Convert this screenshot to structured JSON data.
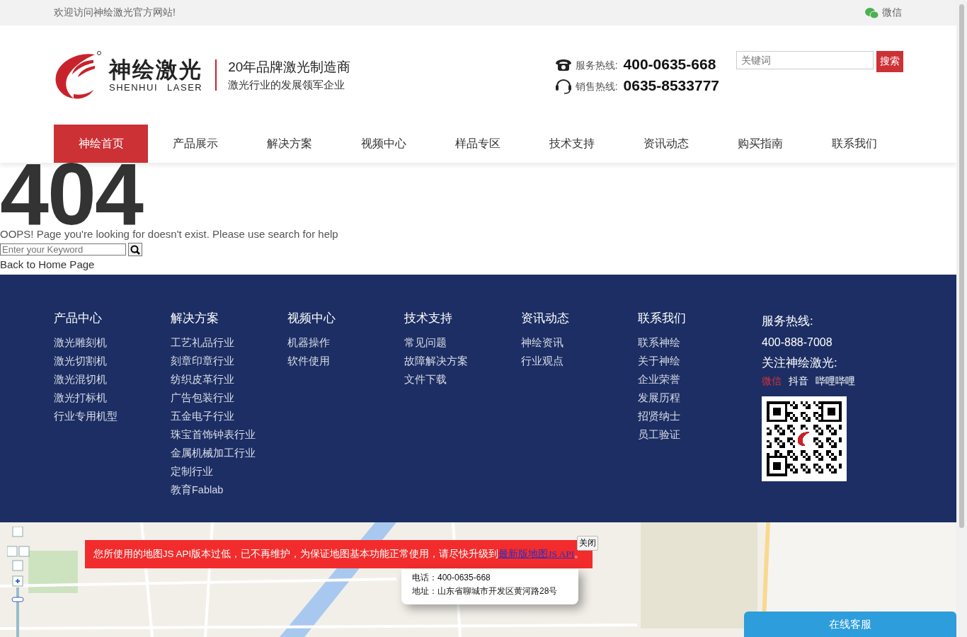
{
  "top_bar": {
    "welcome": "欢迎访问神绘激光官方网站!",
    "wechat": "微信"
  },
  "header": {
    "brand": "神绘激光",
    "brand_en": "SHENHUI LASER",
    "slogan": "20年品牌激光制造商",
    "tagline": "激光行业的发展领军企业",
    "hotlines": [
      {
        "kind": "phone",
        "label": "服务热线:",
        "number": "400-0635-668"
      },
      {
        "kind": "headset",
        "label": "销售热线:",
        "number": "0635-8533777"
      }
    ],
    "search": {
      "placeholder": "关键词",
      "button": "搜索"
    }
  },
  "nav": [
    {
      "label": "神绘首页",
      "selected": true
    },
    {
      "label": "产品展示",
      "selected": false
    },
    {
      "label": "解决方案",
      "selected": false
    },
    {
      "label": "视频中心",
      "selected": false
    },
    {
      "label": "样品专区",
      "selected": false
    },
    {
      "label": "技术支持",
      "selected": false
    },
    {
      "label": "资讯动态",
      "selected": false
    },
    {
      "label": "购买指南",
      "selected": false
    },
    {
      "label": "联系我们",
      "selected": false
    }
  ],
  "error": {
    "code": "404",
    "message": "OOPS! Page you're looking for doesn't exist. Please use search for help",
    "search": {
      "placeholder": "Enter your Keyword"
    },
    "back_link": "Back to Home Page"
  },
  "footer": {
    "columns": [
      {
        "title": "产品中心",
        "links": [
          "激光雕刻机",
          "激光切割机",
          "激光混切机",
          "激光打标机",
          "行业专用机型"
        ]
      },
      {
        "title": "解决方案",
        "links": [
          "工艺礼品行业",
          "刻章印章行业",
          "纺织皮革行业",
          "广告包装行业",
          "五金电子行业",
          "珠宝首饰钟表行业",
          "金属机械加工行业",
          "定制行业",
          "教育Fablab"
        ]
      },
      {
        "title": "视频中心",
        "links": [
          "机器操作",
          "软件使用"
        ]
      },
      {
        "title": "技术支持",
        "links": [
          "常见问题",
          "故障解决方案",
          "文件下载"
        ]
      },
      {
        "title": "资讯动态",
        "links": [
          "神绘资讯",
          "行业观点"
        ]
      },
      {
        "title": "联系我们",
        "links": [
          "联系神绘",
          "关于神绘",
          "企业荣誉",
          "发展历程",
          "招贤纳士",
          "员工验证"
        ]
      }
    ],
    "contact": {
      "hotline_title": "服务热线:",
      "hotline": "400-888-7008",
      "follow_title": "关注神绘激光:",
      "follow": [
        {
          "label": "微信",
          "selected": true
        },
        {
          "label": "抖音",
          "selected": false
        },
        {
          "label": "哔哩哔哩",
          "selected": false
        }
      ]
    }
  },
  "map": {
    "notice": "您所使用的地图JS API版本过低，已不再维护，为保证地图基本功能正常使用，请尽快升级到",
    "notice_link": "最新版地图JS API",
    "notice_end": "。",
    "close": "关闭",
    "info": {
      "phone": "电话：400-0635-668",
      "address": "地址：山东省聊城市开发区黄河路28号"
    }
  },
  "chat_button": "在线客服"
}
